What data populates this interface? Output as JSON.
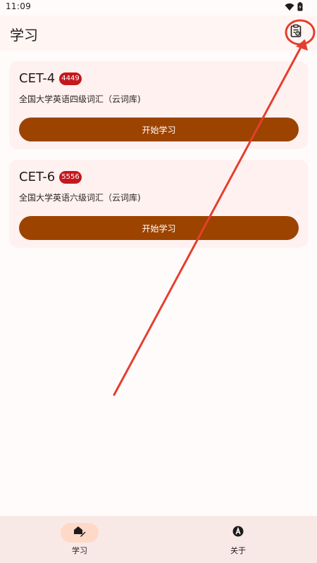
{
  "status_bar": {
    "time": "11:09",
    "icons": [
      "wifi-icon",
      "battery-icon"
    ]
  },
  "app_bar": {
    "title": "学习",
    "action_icon": "clipboard-icon"
  },
  "cards": [
    {
      "title": "CET-4",
      "badge": "4449",
      "subtitle": "全国大学英语四级词汇（云词库)",
      "button_label": "开始学习"
    },
    {
      "title": "CET-6",
      "badge": "5556",
      "subtitle": "全国大学英语六级词汇（云词库)",
      "button_label": "开始学习"
    }
  ],
  "bottom_nav": {
    "items": [
      {
        "label": "学习",
        "icon": "study-icon",
        "active": true
      },
      {
        "label": "关于",
        "icon": "about-icon",
        "active": false
      }
    ]
  },
  "colors": {
    "accent": "#9c4300",
    "badge": "#c4181d",
    "annotation": "#e53e2e",
    "nav_indicator": "#ffd9c8"
  }
}
